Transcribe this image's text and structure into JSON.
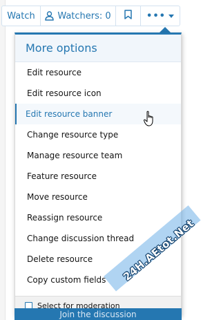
{
  "toolbar": {
    "watch_label": "Watch",
    "watchers_label": "Watchers: 0",
    "bookmark_icon": "bookmark-icon",
    "more_icon": "ellipsis-icon"
  },
  "menu": {
    "title": "More options",
    "items": [
      {
        "label": "Edit resource"
      },
      {
        "label": "Edit resource icon"
      },
      {
        "label": "Edit resource banner"
      },
      {
        "label": "Change resource type"
      },
      {
        "label": "Manage resource team"
      },
      {
        "label": "Feature resource"
      },
      {
        "label": "Move resource"
      },
      {
        "label": "Reassign resource"
      },
      {
        "label": "Change discussion thread"
      },
      {
        "label": "Delete resource"
      },
      {
        "label": "Copy custom fields"
      }
    ],
    "footer_label": "Select for moderation"
  },
  "underlying": {
    "button_label": "Join the discussion"
  },
  "watermark": "24H.AEtot.Net",
  "colors": {
    "accent": "#2577b1",
    "header_bg": "#f1f6fb",
    "footer_bg": "#f1f1f1"
  }
}
